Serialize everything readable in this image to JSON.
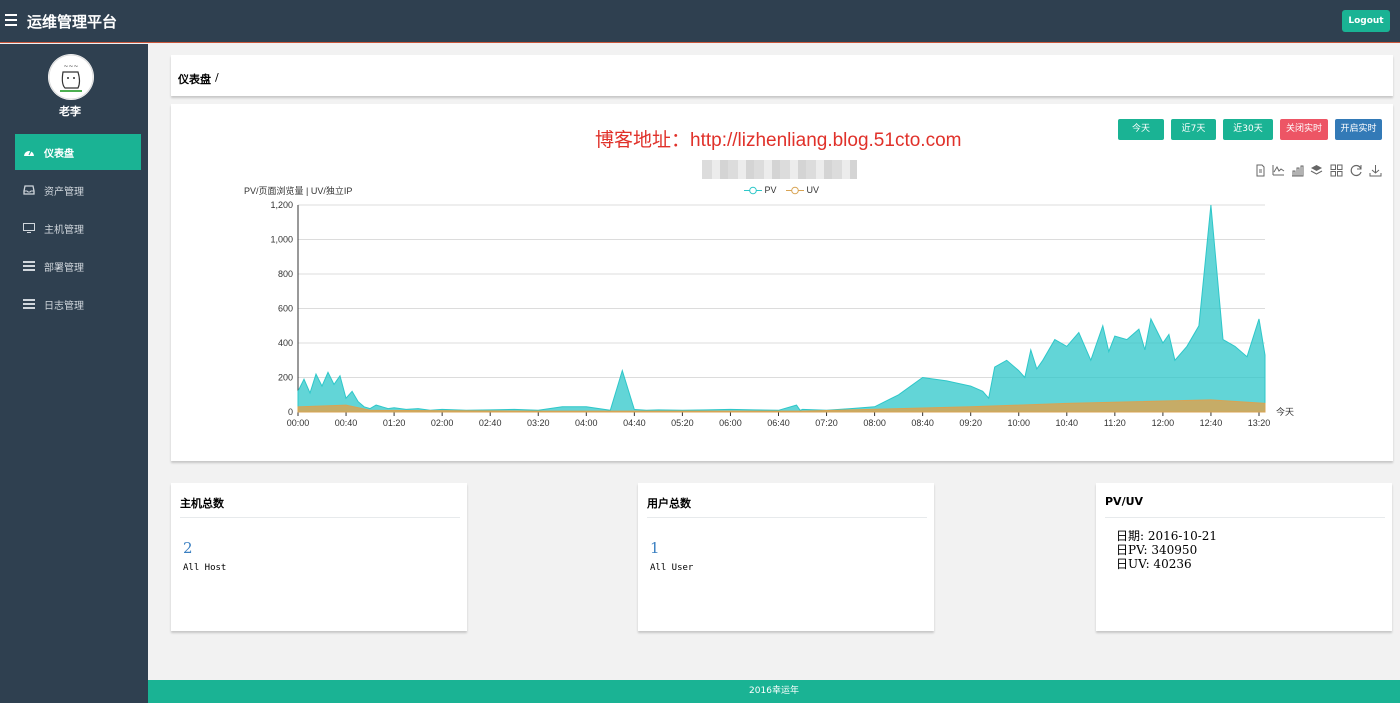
{
  "header": {
    "title": "运维管理平台",
    "logout_label": "Logout"
  },
  "sidebar": {
    "username": "老李",
    "items": [
      {
        "label": "仪表盘",
        "icon": "dashboard-icon",
        "active": true
      },
      {
        "label": "资产管理",
        "icon": "inbox-icon",
        "active": false
      },
      {
        "label": "主机管理",
        "icon": "monitor-icon",
        "active": false
      },
      {
        "label": "部署管理",
        "icon": "list-icon",
        "active": false
      },
      {
        "label": "日志管理",
        "icon": "list-icon",
        "active": false
      }
    ]
  },
  "breadcrumb": {
    "title": "仪表盘",
    "separator": "/"
  },
  "banner": {
    "prefix": "博客地址：",
    "url": "http://lizhenliang.blog.51cto.com"
  },
  "range_buttons": [
    {
      "label": "今天",
      "color": "#1ab394"
    },
    {
      "label": "近7天",
      "color": "#1ab394"
    },
    {
      "label": "近30天",
      "color": "#1ab394"
    },
    {
      "label": "关闭实时",
      "color": "#ed5565"
    },
    {
      "label": "开启实时",
      "color": "#337ab7"
    }
  ],
  "toolbox": [
    "data-view-icon",
    "line-chart-icon",
    "bar-chart-icon",
    "stack-icon",
    "tiled-icon",
    "restore-icon",
    "save-image-icon"
  ],
  "chart_data": {
    "type": "area",
    "ylabel": "PV/页面浏览量 | UV/独立IP",
    "x_axis_name": "今天",
    "ylim": [
      0,
      1200
    ],
    "yticks": [
      "0",
      "200",
      "400",
      "600",
      "800",
      "1,000",
      "1,200"
    ],
    "xticks": [
      "00:00",
      "00:40",
      "01:20",
      "02:00",
      "02:40",
      "03:20",
      "04:00",
      "04:40",
      "05:20",
      "06:00",
      "06:40",
      "07:20",
      "08:00",
      "08:40",
      "09:20",
      "10:00",
      "10:40",
      "11:20",
      "12:00",
      "12:40",
      "13:20"
    ],
    "x_minutes_range": [
      0,
      805
    ],
    "grid": true,
    "legend": "top-center",
    "series": [
      {
        "name": "PV",
        "color": "#2ec7c9",
        "x": [
          0,
          5,
          10,
          15,
          20,
          25,
          30,
          35,
          40,
          45,
          50,
          55,
          60,
          65,
          70,
          75,
          80,
          90,
          100,
          110,
          120,
          140,
          160,
          180,
          200,
          220,
          240,
          260,
          270,
          280,
          290,
          300,
          320,
          340,
          360,
          380,
          400,
          420,
          440,
          460,
          415,
          418,
          480,
          500,
          520,
          540,
          560,
          570,
          575,
          580,
          590,
          600,
          605,
          610,
          615,
          620,
          630,
          640,
          650,
          660,
          665,
          670,
          675,
          680,
          690,
          700,
          705,
          710,
          720,
          725,
          730,
          740,
          750,
          760,
          770,
          780,
          790,
          800,
          805
        ],
        "values": [
          120,
          190,
          110,
          220,
          150,
          230,
          160,
          210,
          80,
          120,
          60,
          30,
          20,
          40,
          30,
          20,
          25,
          15,
          20,
          10,
          15,
          10,
          12,
          15,
          10,
          30,
          30,
          10,
          240,
          15,
          10,
          12,
          10,
          12,
          15,
          12,
          10,
          15,
          10,
          20,
          40,
          10,
          30,
          100,
          200,
          180,
          150,
          120,
          80,
          260,
          300,
          240,
          200,
          360,
          250,
          300,
          420,
          380,
          460,
          300,
          400,
          500,
          350,
          440,
          420,
          480,
          360,
          540,
          400,
          450,
          300,
          380,
          500,
          1200,
          420,
          380,
          320,
          540,
          330
        ]
      },
      {
        "name": "UV",
        "color": "#d8a454",
        "x": [
          0,
          40,
          60,
          200,
          400,
          420,
          500,
          560,
          600,
          640,
          700,
          760,
          805
        ],
        "values": [
          30,
          40,
          10,
          5,
          5,
          5,
          20,
          30,
          40,
          50,
          60,
          70,
          50
        ]
      }
    ]
  },
  "stats": [
    {
      "title": "主机总数",
      "value": "2",
      "sub": "All Host"
    },
    {
      "title": "用户总数",
      "value": "1",
      "sub": "All User"
    }
  ],
  "pvuv": {
    "title": "PV/UV",
    "date_line": "日期: 2016-10-21",
    "pv_line": "日PV: 340950",
    "uv_line": "日UV: 40236"
  },
  "footer": {
    "text": "2016幸运年"
  }
}
